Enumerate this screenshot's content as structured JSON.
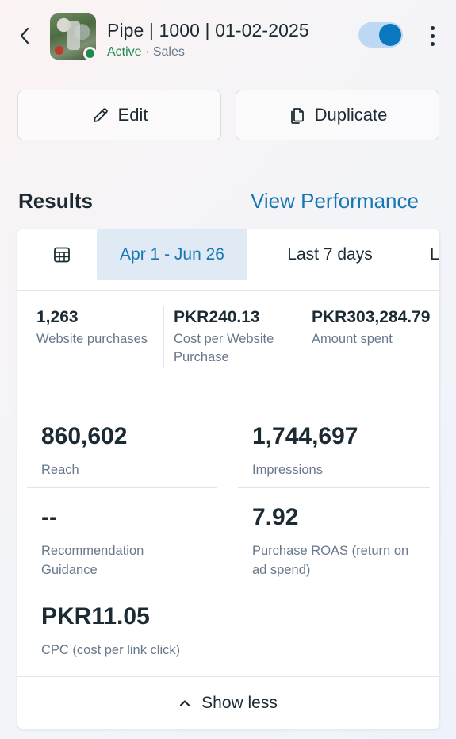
{
  "header": {
    "title": "Pipe | 1000 | 01-02-2025",
    "status": "Active",
    "separator": "·",
    "objective": "Sales",
    "toggle_on": true,
    "accent_color": "#0a78be",
    "active_color": "#1e8a4e"
  },
  "actions": {
    "edit_label": "Edit",
    "duplicate_label": "Duplicate"
  },
  "results": {
    "heading": "Results",
    "view_performance": "View Performance",
    "tabs": [
      "Apr 1 - Jun 26",
      "Last 7 days",
      "L"
    ],
    "selected_tab": "Apr 1 - Jun 26",
    "summary": [
      {
        "value": "1,263",
        "label": "Website purchases"
      },
      {
        "value": "PKR240.13",
        "label": "Cost per Website Purchase"
      },
      {
        "value": "PKR303,284.79",
        "label": "Amount spent"
      }
    ],
    "metrics": [
      {
        "value": "860,602",
        "label": "Reach"
      },
      {
        "value": "1,744,697",
        "label": "Impressions"
      },
      {
        "value": "--",
        "label": "Recommendation Guidance"
      },
      {
        "value": "7.92",
        "label": "Purchase ROAS (return on ad spend)"
      },
      {
        "value": "PKR11.05",
        "label": "CPC (cost per link click)"
      }
    ],
    "show_less": "Show less"
  },
  "icons": [
    "chevron-left-icon",
    "more-vertical-icon",
    "pencil-icon",
    "duplicate-icon",
    "calendar-table-icon",
    "chevron-up-icon"
  ]
}
